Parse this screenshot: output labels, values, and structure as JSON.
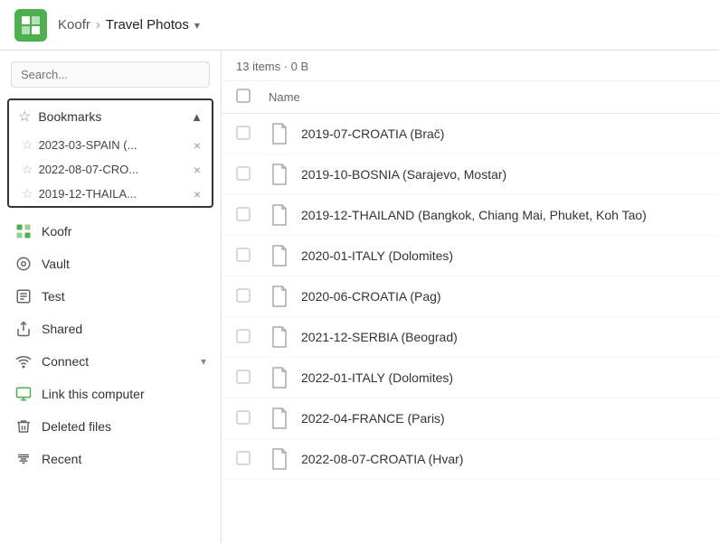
{
  "header": {
    "breadcrumb_root": "Koofr",
    "breadcrumb_current": "Travel Photos",
    "breadcrumb_arrow": "▾"
  },
  "sidebar": {
    "search_placeholder": "Search...",
    "bookmarks": {
      "label": "Bookmarks",
      "chevron": "▲",
      "items": [
        {
          "name": "2023-03-SPAIN (..."
        },
        {
          "name": "2022-08-07-CRO..."
        },
        {
          "name": "2019-12-THAILA..."
        }
      ]
    },
    "nav_items": [
      {
        "id": "koofr",
        "label": "Koofr",
        "icon": "koofr"
      },
      {
        "id": "vault",
        "label": "Vault",
        "icon": "vault"
      },
      {
        "id": "test",
        "label": "Test",
        "icon": "test"
      },
      {
        "id": "shared",
        "label": "Shared",
        "icon": "shared"
      },
      {
        "id": "connect",
        "label": "Connect",
        "icon": "connect",
        "has_arrow": true
      },
      {
        "id": "link-computer",
        "label": "Link this computer",
        "icon": "link-computer"
      },
      {
        "id": "deleted-files",
        "label": "Deleted files",
        "icon": "deleted-files"
      },
      {
        "id": "recent",
        "label": "Recent",
        "icon": "recent"
      }
    ]
  },
  "content": {
    "item_count": "13 items · 0 B",
    "col_name": "Name",
    "files": [
      {
        "name": "2019-07-CROATIA (Brač)"
      },
      {
        "name": "2019-10-BOSNIA (Sarajevo, Mostar)"
      },
      {
        "name": "2019-12-THAILAND (Bangkok, Chiang Mai, Phuket, Koh Tao)"
      },
      {
        "name": "2020-01-ITALY (Dolomites)"
      },
      {
        "name": "2020-06-CROATIA (Pag)"
      },
      {
        "name": "2021-12-SERBIA (Beograd)"
      },
      {
        "name": "2022-01-ITALY (Dolomites)"
      },
      {
        "name": "2022-04-FRANCE (Paris)"
      },
      {
        "name": "2022-08-07-CROATIA (Hvar)"
      }
    ]
  }
}
